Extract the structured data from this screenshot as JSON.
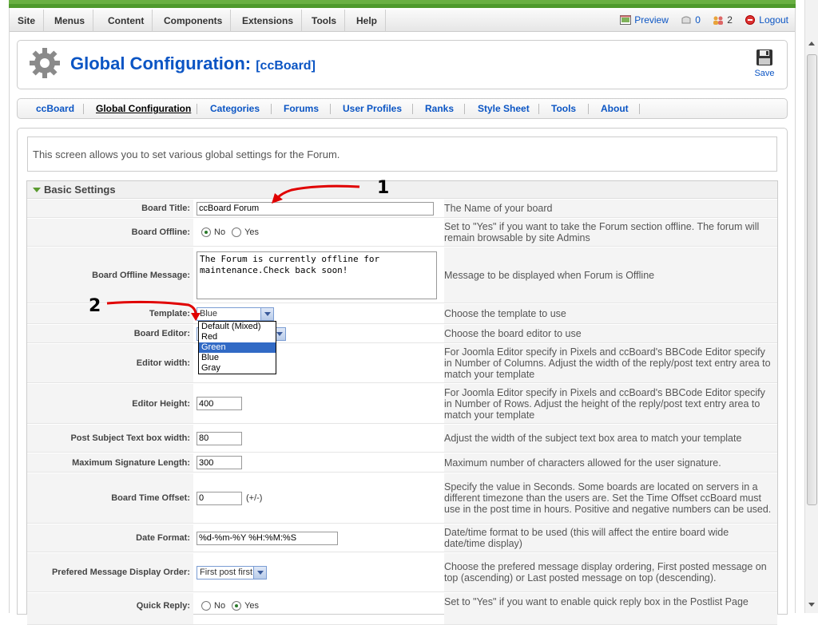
{
  "menubar": {
    "items": [
      "Site",
      "Menus",
      "Content",
      "Components",
      "Extensions",
      "Tools",
      "Help"
    ],
    "status": {
      "preview": "Preview",
      "messages": "0",
      "users": "2",
      "logout": "Logout"
    }
  },
  "header": {
    "title": "Global Configuration:",
    "subtitle": "[ccBoard]",
    "save_label": "Save"
  },
  "submenu": {
    "items": [
      "ccBoard",
      "Global Configuration",
      "Categories",
      "Forums",
      "User Profiles",
      "Ranks",
      "Style Sheet",
      "Tools",
      "About"
    ],
    "active": "Global Configuration"
  },
  "description": "This screen allows you to set various global settings for the Forum.",
  "section": {
    "title": "Basic Settings"
  },
  "fields": {
    "board_title": {
      "label": "Board Title:",
      "value": "ccBoard Forum",
      "help": "The Name of your board"
    },
    "board_offline": {
      "label": "Board Offline:",
      "option_no": "No",
      "option_yes": "Yes",
      "help": "Set to \"Yes\" if you want to take the Forum section offline. The forum will remain browsable by site Admins"
    },
    "offline_message": {
      "label": "Board Offline Message:",
      "value": "The Forum is currently offline for maintenance.Check back soon!",
      "help": "Message to be displayed when Forum is Offline"
    },
    "template": {
      "label": "Template:",
      "value": "Blue",
      "help": "Choose the template to use",
      "options": [
        "Default (Mixed)",
        "Red",
        "Green",
        "Blue",
        "Gray"
      ],
      "highlighted": "Green"
    },
    "board_editor": {
      "label": "Board Editor:",
      "help": "Choose the board editor to use"
    },
    "editor_width": {
      "label": "Editor width:",
      "help": "For Joomla Editor specify in Pixels and ccBoard's BBCode Editor specify in Number of Columns. Adjust the width of the reply/post text entry area to match your template"
    },
    "editor_height": {
      "label": "Editor Height:",
      "value": "400",
      "help": "For Joomla Editor specify in Pixels and ccBoard's BBCode Editor specify in Number of Rows. Adjust the height of the reply/post text entry area to match your template"
    },
    "subject_width": {
      "label": "Post Subject Text box width:",
      "value": "80",
      "help": "Adjust the width of the subject text box area to match your template"
    },
    "sig_length": {
      "label": "Maximum Signature Length:",
      "value": "300",
      "help": "Maximum number of characters allowed for the user signature."
    },
    "time_offset": {
      "label": "Board Time Offset:",
      "value": "0",
      "suffix": "(+/-)",
      "help": "Specify the value in Seconds. Some boards are located on servers in a different timezone than the users are. Set the Time Offset ccBoard must use in the post time in hours. Positive and negative numbers can be used."
    },
    "date_format": {
      "label": "Date Format:",
      "value": "%d-%m-%Y %H:%M:%S",
      "help": "Date/time format to be used (this will affect the entire board wide date/time display)"
    },
    "message_order": {
      "label": "Prefered Message Display Order:",
      "value": "First post first",
      "help": "Choose the prefered message display ordering, First posted message on top (ascending) or Last posted message on top (descending)."
    },
    "quick_reply": {
      "label": "Quick Reply:",
      "option_no": "No",
      "option_yes": "Yes",
      "help": "Set to \"Yes\" if you want to enable quick reply box in the Postlist Page"
    }
  },
  "annotations": {
    "one": "1",
    "two": "2"
  },
  "colors": {
    "accent": "#0b55c4",
    "annotation": "#e00000",
    "topbar": "#6ab043"
  }
}
